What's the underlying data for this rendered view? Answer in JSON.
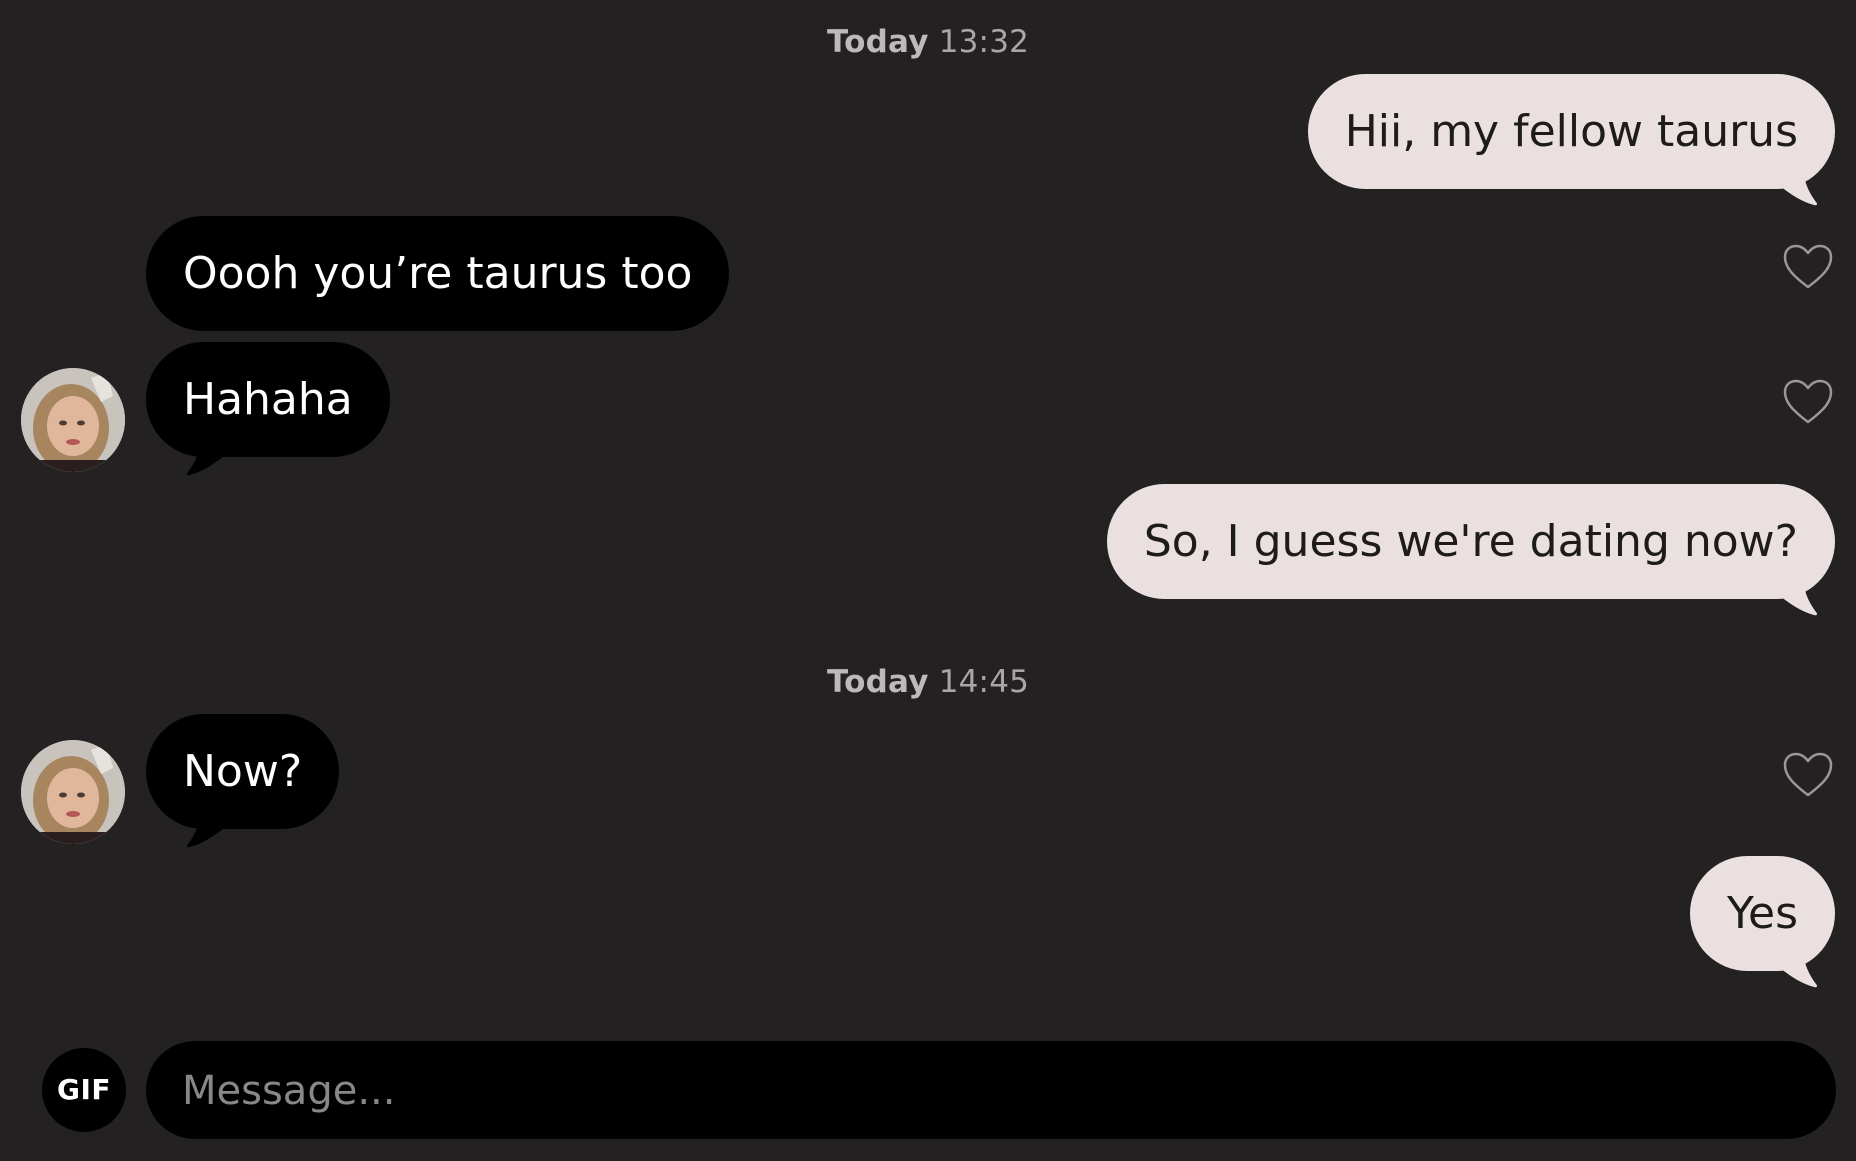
{
  "conversation": {
    "separators": [
      {
        "day": "Today",
        "time": "13:32"
      },
      {
        "day": "Today",
        "time": "14:45"
      }
    ],
    "messages": [
      {
        "direction": "outgoing",
        "text": "Hii, my fellow taurus"
      },
      {
        "direction": "incoming",
        "text": "Oooh you’re taurus too"
      },
      {
        "direction": "incoming",
        "text": "Hahaha"
      },
      {
        "direction": "outgoing",
        "text": "So, I guess we're dating now?"
      },
      {
        "direction": "incoming",
        "text": "Now?"
      },
      {
        "direction": "outgoing",
        "text": "Yes"
      }
    ],
    "icons": {
      "like": "heart-outline-icon",
      "avatar": "contact-avatar"
    }
  },
  "composer": {
    "placeholder": "Message...",
    "value": "",
    "gif_label": "GIF"
  },
  "colors": {
    "background": "#232121",
    "incoming_bubble": "#000000",
    "outgoing_bubble": "#ebe0e0",
    "incoming_text": "#ffffff",
    "outgoing_text": "#1e1b1b"
  }
}
